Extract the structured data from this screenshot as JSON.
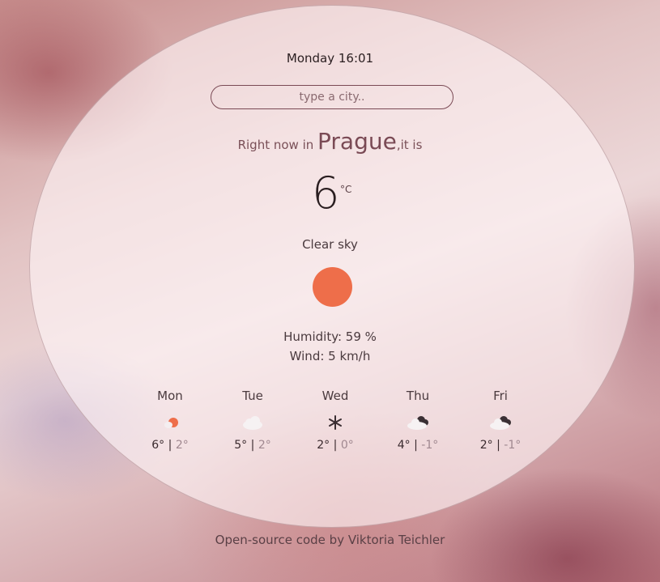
{
  "header": {
    "date_time": "Monday 16:01"
  },
  "search": {
    "placeholder": "type a city.."
  },
  "current": {
    "prefix": "Right now in",
    "city": "Prague",
    "suffix": ",it is",
    "temperature": "6",
    "unit": "°C",
    "description": "Clear sky",
    "icon": "sun-icon",
    "humidity": "Humidity: 59 %",
    "wind": "Wind: 5 km/h"
  },
  "forecast": [
    {
      "day": "Mon",
      "high": "6°",
      "sep": "|",
      "low": "2°",
      "icon": "partly-sunny-icon"
    },
    {
      "day": "Tue",
      "high": "5°",
      "sep": "|",
      "low": "2°",
      "icon": "cloud-icon"
    },
    {
      "day": "Wed",
      "high": "2°",
      "sep": "|",
      "low": "0°",
      "icon": "snowflake-icon"
    },
    {
      "day": "Thu",
      "high": "4°",
      "sep": "|",
      "low": "-1°",
      "icon": "dark-cloud-icon"
    },
    {
      "day": "Fri",
      "high": "2°",
      "sep": "|",
      "low": "-1°",
      "icon": "dark-cloud-icon"
    }
  ],
  "footer": {
    "text": "Open-source code by Viktoria Teichler"
  },
  "colors": {
    "sun": "#ee6e4a",
    "text_dark": "#2a1e20",
    "accent": "#7a4a55"
  }
}
